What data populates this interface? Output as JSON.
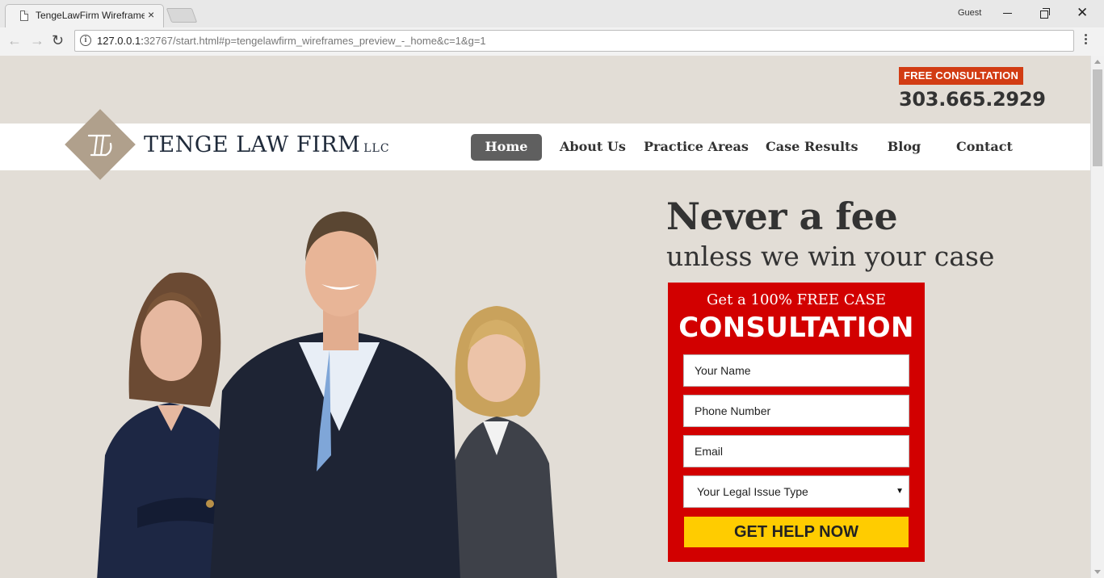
{
  "browser": {
    "tab_title": "TengeLawFirm Wireframe",
    "tab_close": "×",
    "profile": "Guest",
    "url_host": "127.0.0.1:",
    "url_rest": "32767/start.html#p=tengelawfirm_wireframes_preview_-_home&c=1&g=1",
    "back": "←",
    "forward": "→",
    "reload": "↻",
    "close": "✕",
    "info": "i"
  },
  "header": {
    "consult_badge": "FREE CONSULTATION",
    "phone": "303.665.2929",
    "firm_name": "TENGE LAW FIRM",
    "firm_suffix": "LLC"
  },
  "nav": {
    "items": [
      {
        "label": "Home",
        "active": true
      },
      {
        "label": "About Us"
      },
      {
        "label": "Practice Areas"
      },
      {
        "label": "Case Results"
      },
      {
        "label": "Blog"
      },
      {
        "label": "Contact"
      }
    ]
  },
  "hero": {
    "headline": "Never a fee",
    "subhead": "unless we win your case"
  },
  "form": {
    "lead": "Get a 100% FREE CASE",
    "title": "CONSULTATION",
    "name_placeholder": "Your Name",
    "phone_placeholder": "Phone Number",
    "email_placeholder": "Email",
    "issue_select": "Your Legal Issue Type",
    "submit": "GET HELP NOW"
  },
  "colors": {
    "page_bg": "#e2ddd6",
    "badge": "#d23c13",
    "form_bg": "#d20000",
    "submit": "#ffcc00",
    "nav_active": "#5f5f5f",
    "logo": "#b0a08c"
  }
}
